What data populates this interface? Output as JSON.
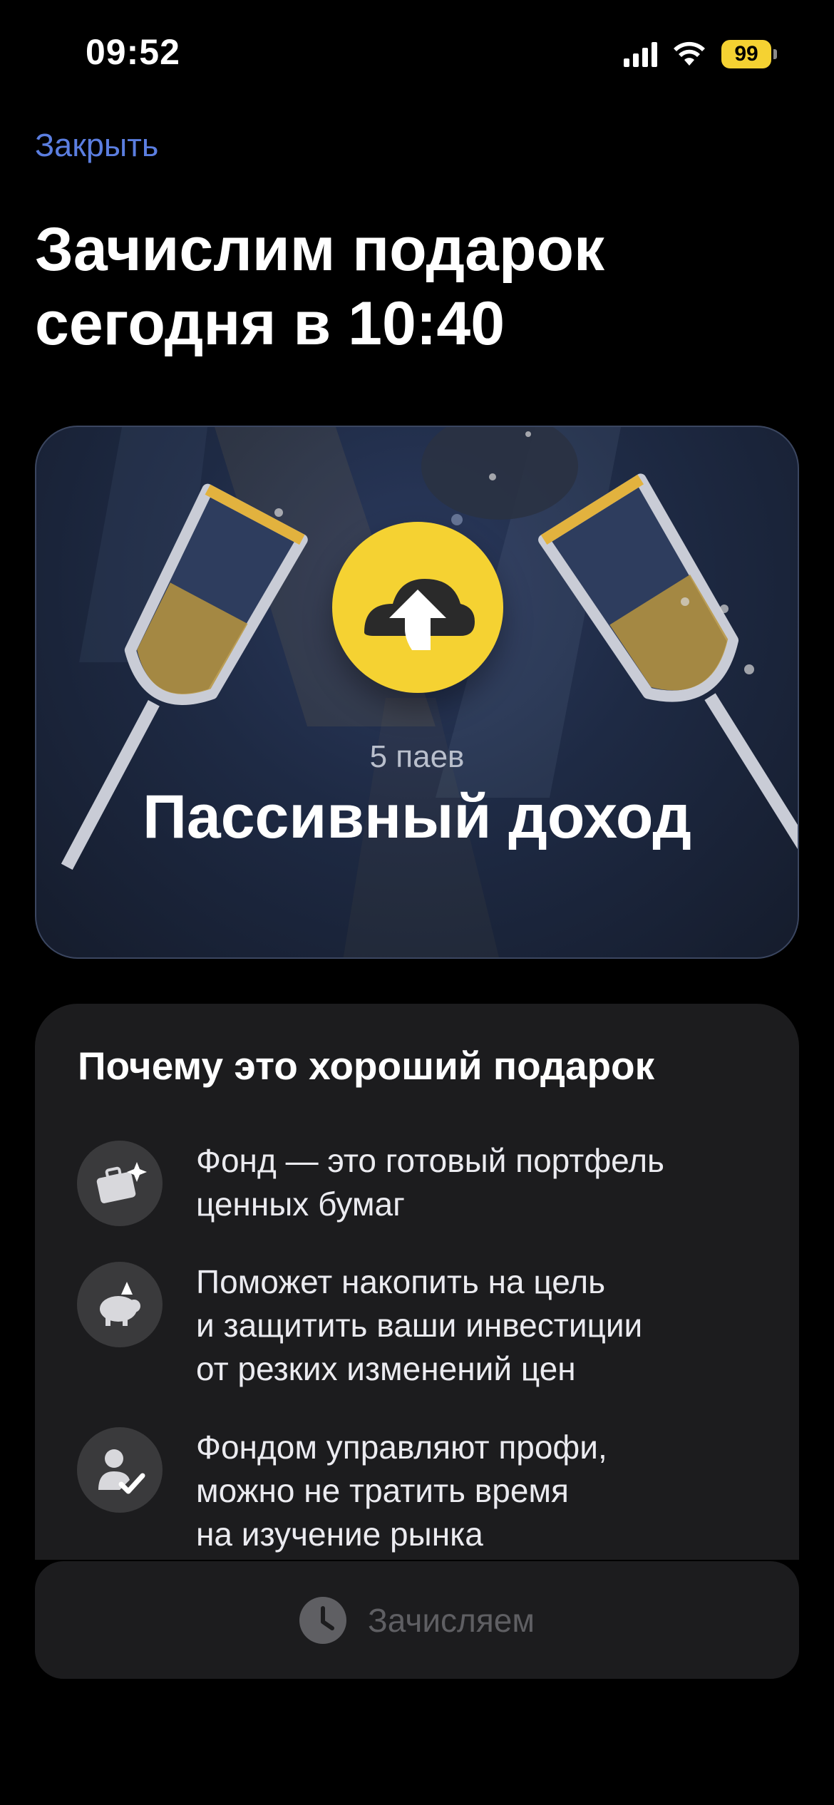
{
  "status_bar": {
    "time": "09:52",
    "battery_level": "99",
    "battery_color": "#f5d232"
  },
  "header": {
    "close_label": "Закрыть",
    "title": "Зачислим подарок сегодня в 10:40"
  },
  "gift_card": {
    "logo_icon": "cloud-arrow-up-icon",
    "count": "5 паев",
    "name": "Пассивный доход"
  },
  "why_section": {
    "title": "Почему это хороший подарок",
    "items": [
      {
        "icon": "briefcase-sparkle-icon",
        "text": "Фонд — это готовый портфель\nценных бумаг"
      },
      {
        "icon": "piggy-bank-icon",
        "text": "Поможет накопить на цель\nи защитить ваши инвестиции\nот резких изменений цен"
      },
      {
        "icon": "manager-check-icon",
        "text": "Фондом управляют профи,\nможно не тратить время\nна изучение рынка"
      }
    ]
  },
  "bottom_button": {
    "icon": "clock-icon",
    "label": "Зачисляем"
  },
  "colors": {
    "accent_link": "#5b7ee0",
    "brand_yellow": "#f5d232",
    "panel_bg": "#1c1c1e",
    "disabled_text": "#5f5f63"
  }
}
